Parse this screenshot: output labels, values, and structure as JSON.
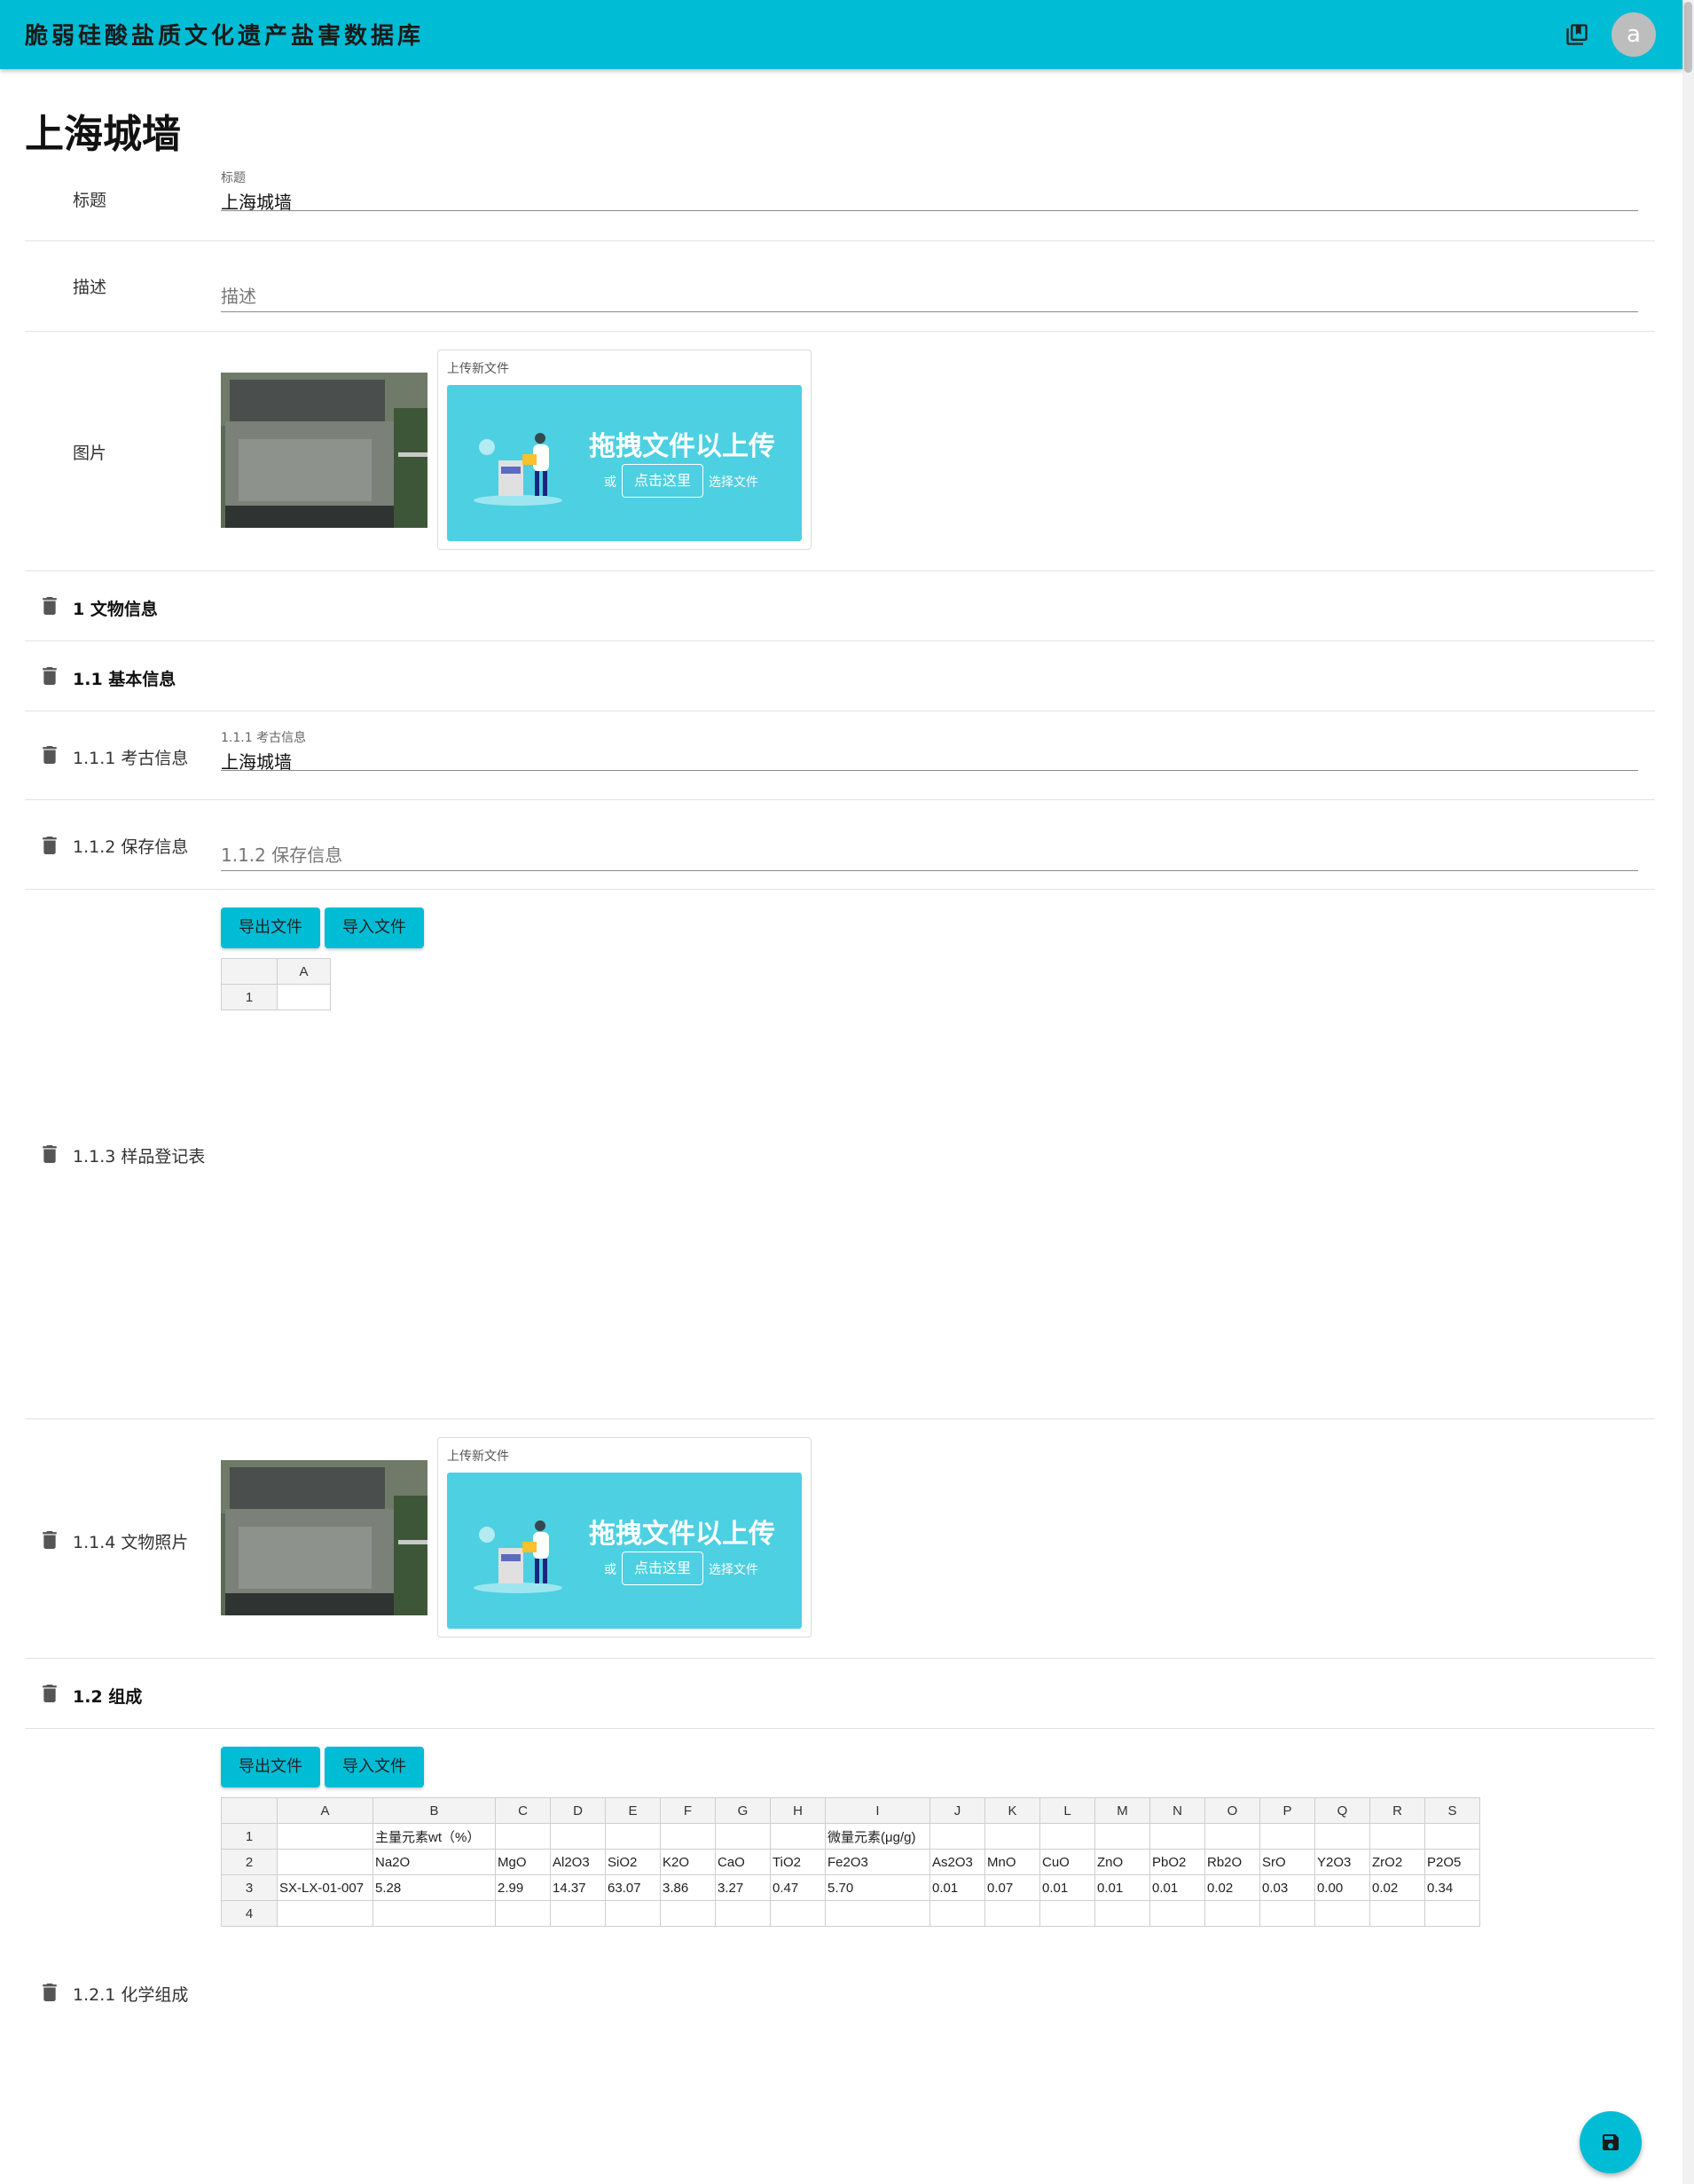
{
  "app": {
    "title": "脆弱硅酸盐质文化遗产盐害数据库",
    "library_icon": "library-books-icon",
    "avatar_letter": "a"
  },
  "page": {
    "title": "上海城墙"
  },
  "fields": {
    "title": {
      "label": "标题",
      "float_label": "标题",
      "value": "上海城墙"
    },
    "description": {
      "label": "描述",
      "placeholder": "描述"
    },
    "image": {
      "label": "图片"
    }
  },
  "uploader": {
    "caption": "上传新文件",
    "drag_text": "拖拽文件以上传",
    "or_text": "或",
    "click_text": "点击这里",
    "choose_text": "选择文件"
  },
  "sections": {
    "s1": "1 文物信息",
    "s1_1": "1.1 基本信息",
    "s1_1_1": {
      "label": "1.1.1 考古信息",
      "float_label": "1.1.1 考古信息",
      "value": "上海城墙"
    },
    "s1_1_2": {
      "label": "1.1.2 保存信息",
      "placeholder": "1.1.2 保存信息"
    },
    "s1_1_3": "1.1.3 样品登记表",
    "s1_1_4": "1.1.4 文物照片",
    "s1_2": "1.2 组成",
    "s1_2_1": "1.2.1 化学组成"
  },
  "buttons": {
    "export": "导出文件",
    "import": "导入文件"
  },
  "sheet_small": {
    "columns": [
      "A"
    ],
    "rows": [
      [
        "1",
        ""
      ]
    ]
  },
  "sheet_large": {
    "columns": [
      "A",
      "B",
      "C",
      "D",
      "E",
      "F",
      "G",
      "H",
      "I",
      "J",
      "K",
      "L",
      "M",
      "N",
      "O",
      "P",
      "Q",
      "R",
      "S"
    ],
    "rows": [
      [
        "1",
        "",
        "主量元素wt（%）",
        "",
        "",
        "",
        "",
        "",
        "",
        "微量元素(μg/g)",
        "",
        "",
        "",
        "",
        "",
        "",
        "",
        "",
        "",
        ""
      ],
      [
        "2",
        "",
        "Na2O",
        "MgO",
        "Al2O3",
        "SiO2",
        "K2O",
        "CaO",
        "TiO2",
        "Fe2O3",
        "As2O3",
        "MnO",
        "CuO",
        "ZnO",
        "PbO2",
        "Rb2O",
        "SrO",
        "Y2O3",
        "ZrO2",
        "P2O5"
      ],
      [
        "3",
        "SX-LX-01-007",
        "5.28",
        "2.99",
        "14.37",
        "63.07",
        "3.86",
        "3.27",
        "0.47",
        "5.70",
        "0.01",
        "0.07",
        "0.01",
        "0.01",
        "0.01",
        "0.02",
        "0.03",
        "0.00",
        "0.02",
        "0.34"
      ],
      [
        "4",
        "",
        "",
        "",
        "",
        "",
        "",
        "",
        "",
        "",
        "",
        "",
        "",
        "",
        "",
        "",
        "",
        "",
        "",
        ""
      ]
    ]
  },
  "fab": {
    "icon": "save-icon"
  }
}
